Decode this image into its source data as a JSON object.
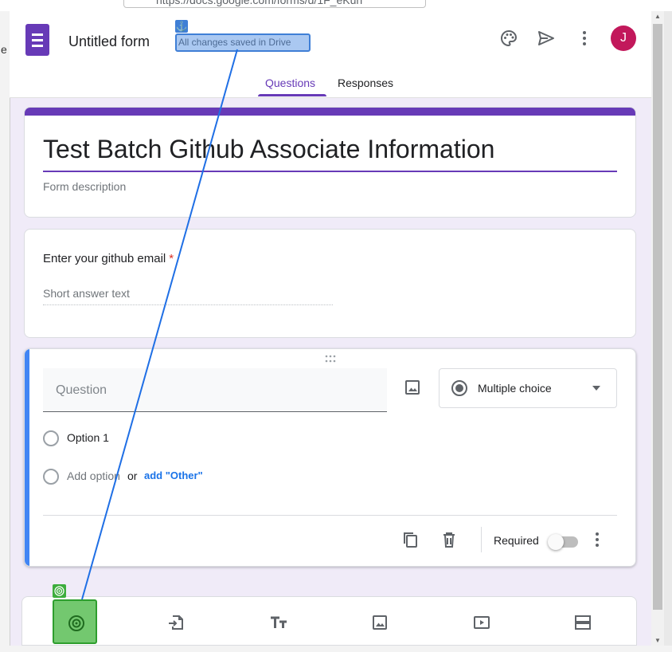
{
  "browser": {
    "url_text": "https://docs.google.com/forms/d/1F_eKuh",
    "left_edge_char": "e"
  },
  "header": {
    "form_title": "Untitled form",
    "save_status": "All changes saved in Drive",
    "avatar_initial": "J",
    "icons": [
      "palette-icon",
      "send-icon",
      "more-vert-icon"
    ],
    "tabs": [
      {
        "label": "Questions",
        "active": true
      },
      {
        "label": "Responses",
        "active": false
      }
    ]
  },
  "title_card": {
    "title": "Test Batch Github Associate Information",
    "description_placeholder": "Form description"
  },
  "question1": {
    "label": "Enter your github email",
    "required_mark": "*",
    "answer_placeholder": "Short answer text"
  },
  "question2": {
    "question_placeholder": "Question",
    "type": "Multiple choice",
    "options": [
      {
        "label": "Option 1"
      }
    ],
    "add_option": "Add option",
    "or": "or",
    "add_other": "add \"Other\"",
    "required_label": "Required",
    "required_on": false
  },
  "toolbar": {
    "icons": [
      "add-question-icon",
      "import-questions-icon",
      "add-title-icon",
      "add-image-icon",
      "add-video-icon",
      "add-section-icon"
    ]
  },
  "colors": {
    "brand": "#673ab7",
    "background": "#f0ebf8",
    "active_border": "#4285f4",
    "avatar": "#c2185b",
    "link": "#1a73e8"
  }
}
